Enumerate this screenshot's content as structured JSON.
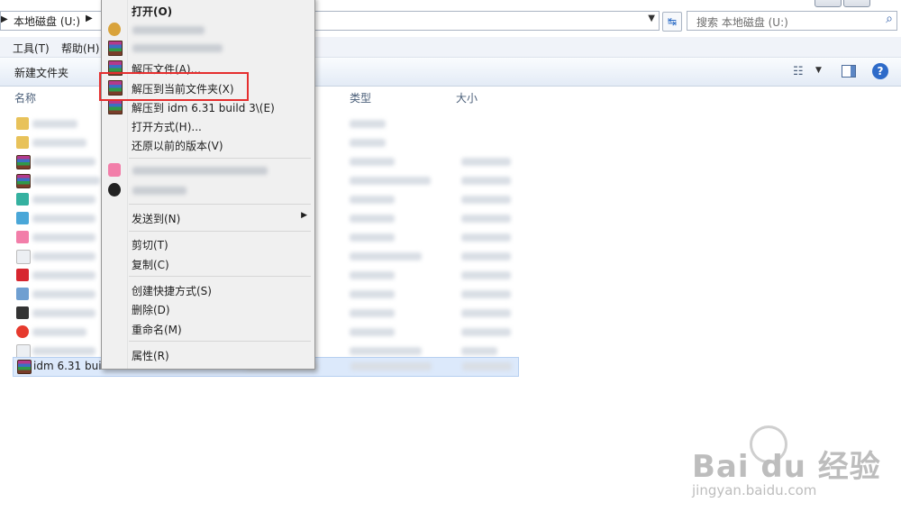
{
  "address": {
    "crumb": "本地磁盘 (U:)"
  },
  "search": {
    "placeholder": "搜索 本地磁盘 (U:)"
  },
  "menubar": {
    "tools": "工具(T)",
    "help": "帮助(H)"
  },
  "command": {
    "new_folder": "新建文件夹"
  },
  "columns": {
    "name": "名称",
    "type": "类型",
    "size": "大小"
  },
  "file_selected": {
    "name": "idm 6.31 build 3.rar"
  },
  "context_menu": {
    "open": "打开(O)",
    "extract_files": "解压文件(A)...",
    "extract_here": "解压到当前文件夹(X)",
    "extract_to": "解压到 idm 6.31 build 3\\(E)",
    "open_with": "打开方式(H)...",
    "restore_versions": "还原以前的版本(V)",
    "send_to": "发送到(N)",
    "cut": "剪切(T)",
    "copy": "复制(C)",
    "create_shortcut": "创建快捷方式(S)",
    "delete": "删除(D)",
    "rename": "重命名(M)",
    "properties": "属性(R)"
  },
  "watermark": {
    "brand": "Bai du 经验",
    "url": "jingyan.baidu.com"
  },
  "colors": {
    "highlight_border": "#e52e2e",
    "selected_row": "#dce9fb"
  }
}
